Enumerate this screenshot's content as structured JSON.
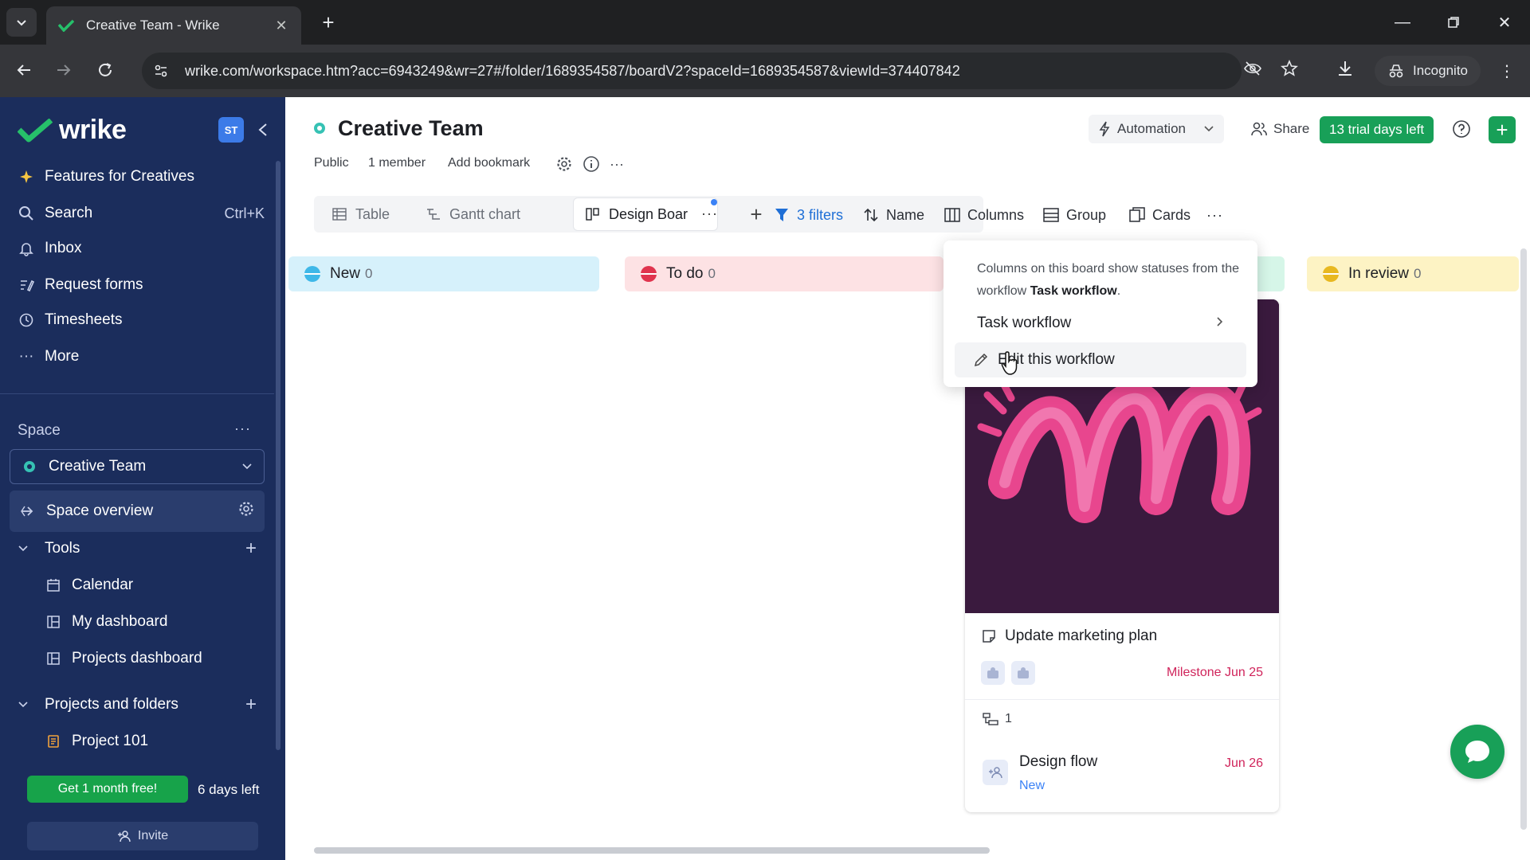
{
  "browser": {
    "tab_title": "Creative Team - Wrike",
    "url": "wrike.com/workspace.htm?acc=6943249&wr=27#/folder/1689354587/boardV2?spaceId=1689354587&viewId=374407842",
    "incognito_label": "Incognito"
  },
  "sidebar": {
    "logo_text": "wrike",
    "avatar_initials": "ST",
    "items": [
      {
        "label": "Features for Creatives",
        "icon": "sparkle-icon"
      },
      {
        "label": "Search",
        "shortcut": "Ctrl+K",
        "icon": "search-icon"
      },
      {
        "label": "Inbox",
        "icon": "bell-icon"
      },
      {
        "label": "Request forms",
        "icon": "form-icon"
      },
      {
        "label": "Timesheets",
        "icon": "clock-icon"
      },
      {
        "label": "More",
        "icon": "more-icon"
      }
    ],
    "space_label": "Space",
    "space_name": "Creative Team",
    "space_overview": "Space overview",
    "tools_label": "Tools",
    "tools": [
      {
        "label": "Calendar",
        "icon": "calendar-icon"
      },
      {
        "label": "My dashboard",
        "icon": "dashboard-icon"
      },
      {
        "label": "Projects dashboard",
        "icon": "dashboard-icon"
      }
    ],
    "projects_label": "Projects and folders",
    "projects": [
      {
        "label": "Project 101",
        "icon": "project-icon"
      }
    ],
    "promo_button": "Get 1 month free!",
    "days_left": "6 days left",
    "invite_label": "Invite"
  },
  "header": {
    "title": "Creative Team",
    "visibility": "Public",
    "members": "1 member",
    "bookmark": "Add bookmark",
    "automation": "Automation",
    "share": "Share",
    "trial": "13 trial days left"
  },
  "views": {
    "tabs": [
      {
        "label": "Table",
        "icon": "table-icon"
      },
      {
        "label": "Gantt chart",
        "icon": "gantt-icon"
      },
      {
        "label": "Design Boar",
        "icon": "board-icon"
      }
    ],
    "filters": "3 filters",
    "sort": "Name",
    "columns": "Columns",
    "group": "Group",
    "cards": "Cards"
  },
  "board": {
    "columns": [
      {
        "name": "New",
        "count": "0",
        "bg": "#d6f1fb",
        "dot": "#3fb8e8"
      },
      {
        "name": "To do",
        "count": "0",
        "bg": "#fde2e4",
        "dot": "#e0344e"
      },
      {
        "name": "In review",
        "count": "0",
        "bg": "#fdf3c4",
        "dot": "#e8b820"
      }
    ],
    "card": {
      "title": "Update marketing plan",
      "milestone": "Milestone Jun 25",
      "subtask_count": "1",
      "subtask": {
        "name": "Design flow",
        "status": "New",
        "date": "Jun 26"
      }
    }
  },
  "popup": {
    "desc_prefix": "Columns on this board show statuses from the workflow",
    "desc_workflow": "Task workflow",
    "desc_suffix": ".",
    "item_workflow": "Task workflow",
    "item_edit": "Edit this workflow"
  },
  "colors": {
    "sidebar_bg": "#1b2d5c",
    "accent_green": "#18a058",
    "milestone_red": "#d0245b"
  }
}
